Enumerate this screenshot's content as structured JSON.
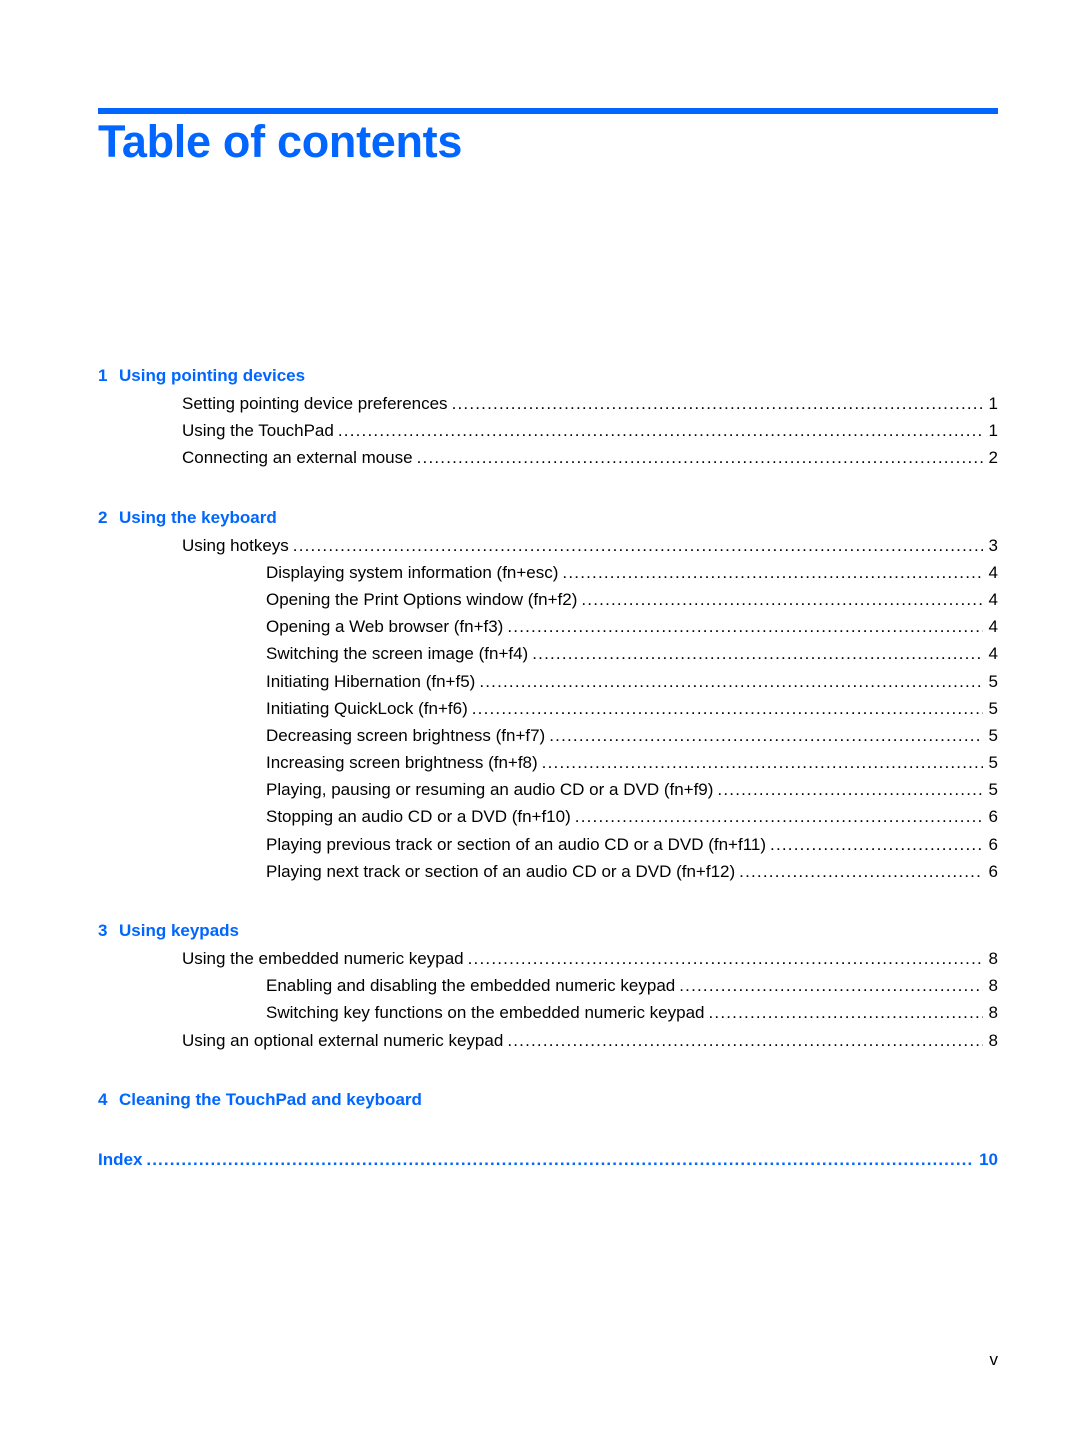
{
  "page": {
    "title": "Table of contents",
    "accent_color": "#0066ff",
    "folio": "v"
  },
  "toc": {
    "chapters": [
      {
        "number": "1",
        "title": "Using pointing devices",
        "entries": [
          {
            "level": 1,
            "label": "Setting pointing device preferences",
            "page": "1"
          },
          {
            "level": 1,
            "label": "Using the TouchPad",
            "page": "1"
          },
          {
            "level": 1,
            "label": "Connecting an external mouse",
            "page": "2"
          }
        ]
      },
      {
        "number": "2",
        "title": "Using the keyboard",
        "entries": [
          {
            "level": 1,
            "label": "Using hotkeys",
            "page": "3"
          },
          {
            "level": 2,
            "label": "Displaying system information (fn+esc)",
            "page": "4"
          },
          {
            "level": 2,
            "label": "Opening the Print Options window (fn+f2)",
            "page": "4"
          },
          {
            "level": 2,
            "label": "Opening a Web browser (fn+f3)",
            "page": "4"
          },
          {
            "level": 2,
            "label": "Switching the screen image (fn+f4)",
            "page": "4"
          },
          {
            "level": 2,
            "label": "Initiating Hibernation (fn+f5)",
            "page": "5"
          },
          {
            "level": 2,
            "label": "Initiating QuickLock (fn+f6)",
            "page": "5"
          },
          {
            "level": 2,
            "label": "Decreasing screen brightness (fn+f7)",
            "page": "5"
          },
          {
            "level": 2,
            "label": "Increasing screen brightness (fn+f8)",
            "page": "5"
          },
          {
            "level": 2,
            "label": "Playing, pausing or resuming an audio CD or a DVD (fn+f9)",
            "page": "5"
          },
          {
            "level": 2,
            "label": "Stopping an audio CD or a DVD (fn+f10)",
            "page": "6"
          },
          {
            "level": 2,
            "label": "Playing previous track or section of an audio CD or a DVD (fn+f11)",
            "page": "6"
          },
          {
            "level": 2,
            "label": "Playing next track or section of an audio CD or a DVD (fn+f12)",
            "page": "6"
          }
        ]
      },
      {
        "number": "3",
        "title": "Using keypads",
        "entries": [
          {
            "level": 1,
            "label": "Using the embedded numeric keypad",
            "page": "8"
          },
          {
            "level": 2,
            "label": "Enabling and disabling the embedded numeric keypad",
            "page": "8"
          },
          {
            "level": 2,
            "label": "Switching key functions on the embedded numeric keypad",
            "page": "8"
          },
          {
            "level": 1,
            "label": "Using an optional external numeric keypad",
            "page": "8"
          }
        ]
      },
      {
        "number": "4",
        "title": "Cleaning the TouchPad and keyboard",
        "entries": []
      }
    ],
    "index": {
      "label": "Index",
      "page": "10"
    }
  }
}
